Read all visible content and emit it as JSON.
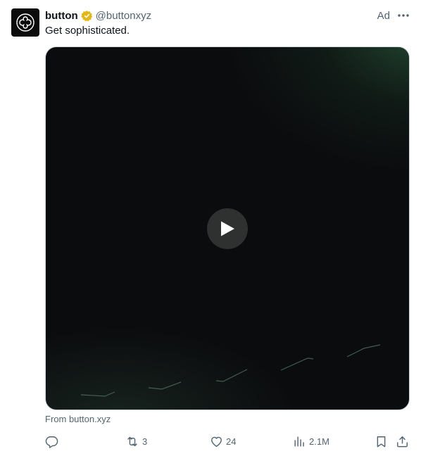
{
  "author": {
    "name": "button",
    "handle": "@buttonxyz",
    "verified_color": "#e2b719"
  },
  "ad_label": "Ad",
  "post_text": "Get sophisticated.",
  "media": {
    "type": "video",
    "icon": "play-icon"
  },
  "source_text": "From button.xyz",
  "actions": {
    "reply": {
      "icon": "reply-icon",
      "count": ""
    },
    "repost": {
      "icon": "repost-icon",
      "count": "3"
    },
    "like": {
      "icon": "heart-icon",
      "count": "24"
    },
    "views": {
      "icon": "views-icon",
      "count": "2.1M"
    },
    "bookmark": {
      "icon": "bookmark-icon"
    },
    "share": {
      "icon": "share-icon"
    }
  },
  "colors": {
    "text_primary": "#0f1419",
    "text_secondary": "#536471",
    "media_background": "#0b0c0e",
    "media_glow": "#224630"
  }
}
